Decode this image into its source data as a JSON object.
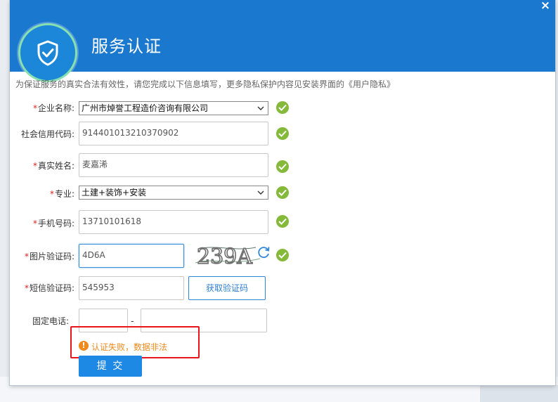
{
  "window": {
    "title": "服务认证",
    "close_glyph": "×"
  },
  "notice": "为保证服务的真实合法有效性，请您完成以下信息填写，更多隐私保护内容见安装界面的《用户隐私》",
  "form": {
    "required_mark": "*",
    "company": {
      "label": "企业名称:",
      "value": "广州市焯誉工程造价咨询有限公司"
    },
    "credit_code": {
      "label": "社会信用代码:",
      "value": "914401013210370902"
    },
    "real_name": {
      "label": "真实姓名:",
      "value": "麦嘉浠"
    },
    "specialty": {
      "label": "专业:",
      "value": "土建+装饰+安装"
    },
    "phone": {
      "label": "手机号码:",
      "value": "13710101618"
    },
    "image_captcha": {
      "label": "图片验证码:",
      "value": "4D6A",
      "image_text": "239A"
    },
    "sms_code": {
      "label": "短信验证码:",
      "value": "545953",
      "button": "获取验证码"
    },
    "landline": {
      "label": "固定电话:",
      "area_code": "",
      "number": "",
      "separator": "-"
    }
  },
  "error": {
    "icon": "!",
    "message": "认证失败，数据非法"
  },
  "submit_label": "提 交",
  "icons": {
    "badge": "shield-check-icon",
    "check": "check-circle-icon",
    "refresh": "refresh-icon"
  },
  "colors": {
    "header": "#1b78cf",
    "success": "#84b939",
    "error_border": "#e8161b",
    "warning": "#ef8a1e",
    "submit": "#1e88e5"
  }
}
